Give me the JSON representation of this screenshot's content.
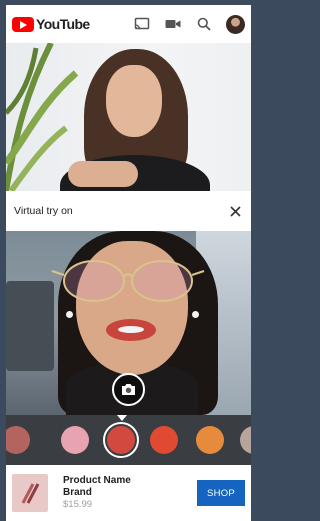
{
  "app": {
    "logo_text": "YouTube"
  },
  "appbar": {
    "icons": [
      "cast-icon",
      "camera-icon",
      "search-icon",
      "account-avatar"
    ]
  },
  "tryon": {
    "title": "Virtual try on"
  },
  "swatches": {
    "colors": [
      "#b4645f",
      "#e8a3b1",
      "#d24a3f",
      "#e04a32",
      "#e68a3c",
      "#b7a49c"
    ],
    "selected_index": 2
  },
  "product": {
    "name": "Product Name",
    "brand": "Brand",
    "price": "$15.99",
    "shop_label": "SHOP"
  },
  "colors": {
    "brand_red": "#ff0000",
    "shop_blue": "#1565c0",
    "page_background": "#3b4a5c"
  }
}
